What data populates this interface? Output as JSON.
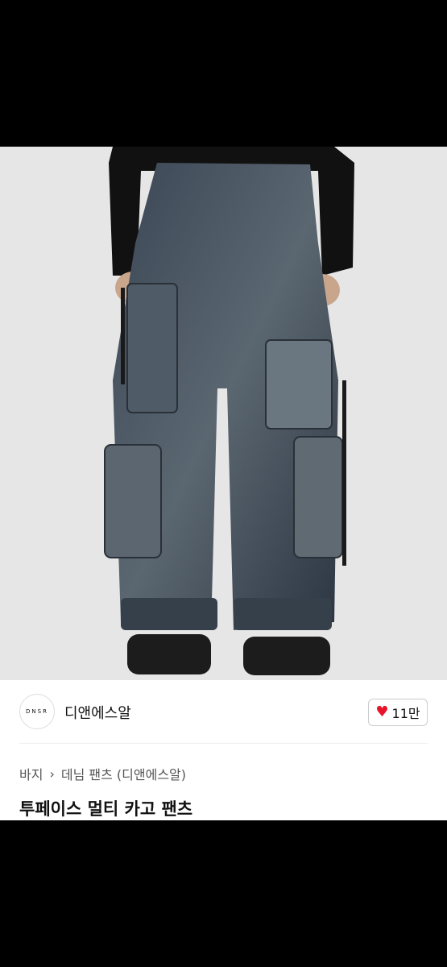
{
  "hero": {
    "expand_icon": "expand-icon",
    "thumb_chevron": "›"
  },
  "brand": {
    "logo_text": "DNSR",
    "name": "디앤에스알"
  },
  "like": {
    "count": "11만",
    "icon": "heart-icon",
    "color": "#e8142b"
  },
  "breadcrumb": {
    "items": [
      "바지",
      "데님 팬츠 (디앤에스알)"
    ],
    "separator": "›"
  },
  "product": {
    "title": "투페이스 멀티 카고 팬츠"
  }
}
